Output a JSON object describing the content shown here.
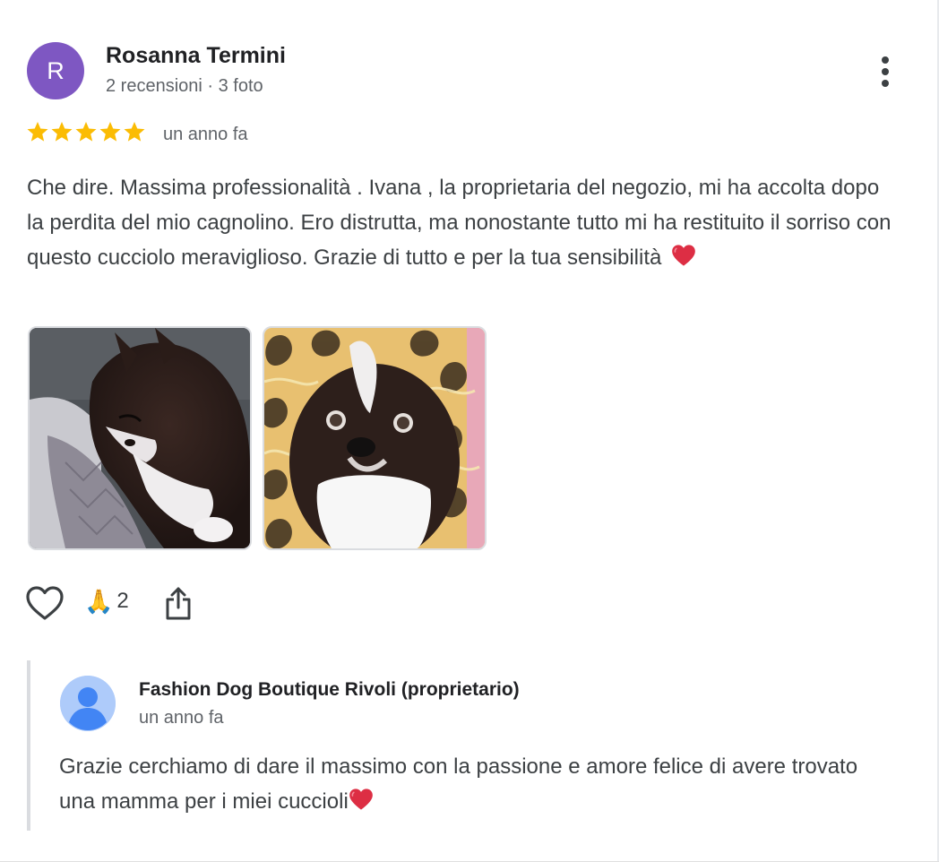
{
  "reviewer": {
    "avatar_letter": "R",
    "avatar_color": "#7e57c2",
    "name": "Rosanna Termini",
    "meta": "2 recensioni · 3 foto"
  },
  "review": {
    "rating": 5,
    "star_color": "#fbbc04",
    "time": "un anno fa",
    "text": "Che dire. Massima professionalità . Ivana , la proprietaria del negozio, mi ha accolta dopo la perdita del mio cagnolino. Ero distrutta, ma nonostante tutto mi ha restituito il sorriso con questo cucciolo meraviglioso. Grazie di tutto e per la tua sensibilità",
    "photos": [
      {
        "name": "photo-sleeping-puppy"
      },
      {
        "name": "photo-puppy-portrait"
      }
    ]
  },
  "actions": {
    "reaction_emoji": "🙏",
    "reaction_count": "2"
  },
  "owner_reply": {
    "name": "Fashion Dog Boutique Rivoli (proprietario)",
    "time": "un anno fa",
    "text": "Grazie cerchiamo di dare il massimo con la passione e amore felice di avere trovato una mamma per i miei cuccioli"
  },
  "icons": [
    "more-vert-icon",
    "star-icon",
    "heart-emoji-icon",
    "like-heart-icon",
    "share-icon",
    "default-avatar-icon"
  ]
}
